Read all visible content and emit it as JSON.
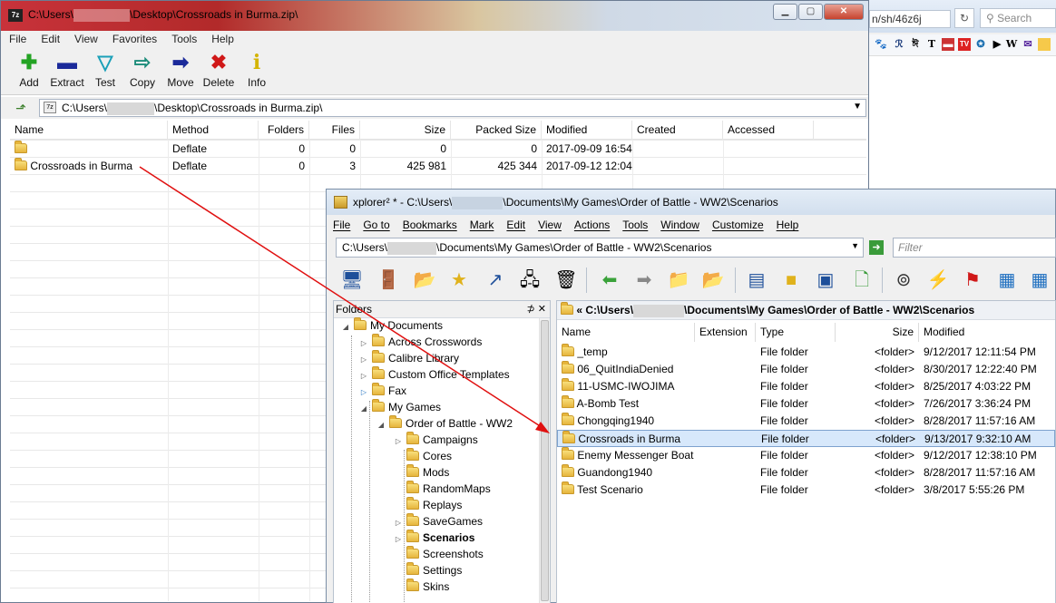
{
  "browser": {
    "url_fragment": "n/sh/46z6j",
    "search_placeholder": "Search"
  },
  "sevenzip": {
    "title_prefix": "C:\\Users\\",
    "title_suffix": "\\Desktop\\Crossroads in Burma.zip\\",
    "menu": [
      "File",
      "Edit",
      "View",
      "Favorites",
      "Tools",
      "Help"
    ],
    "toolbar": [
      {
        "label": "Add",
        "icon": "add-icon",
        "color": "#23a323"
      },
      {
        "label": "Extract",
        "icon": "extract-icon",
        "color": "#1b2a9a"
      },
      {
        "label": "Test",
        "icon": "test-icon",
        "color": "#1aa0b8"
      },
      {
        "label": "Copy",
        "icon": "copy-icon",
        "color": "#1c8c7a"
      },
      {
        "label": "Move",
        "icon": "move-icon",
        "color": "#1b2a9a"
      },
      {
        "label": "Delete",
        "icon": "delete-icon",
        "color": "#d01818"
      },
      {
        "label": "Info",
        "icon": "info-icon",
        "color": "#d4b400"
      }
    ],
    "address_prefix": "C:\\Users\\",
    "address_suffix": "\\Desktop\\Crossroads in Burma.zip\\",
    "columns": [
      "Name",
      "Method",
      "Folders",
      "Files",
      "Size",
      "Packed Size",
      "Modified",
      "Created",
      "Accessed"
    ],
    "rows": [
      {
        "name": "",
        "method": "Deflate",
        "folders": "0",
        "files": "0",
        "size": "0",
        "packed": "0",
        "modified": "2017-09-09 16:54",
        "created": "",
        "accessed": ""
      },
      {
        "name": "Crossroads in Burma",
        "method": "Deflate",
        "folders": "0",
        "files": "3",
        "size": "425 981",
        "packed": "425 344",
        "modified": "2017-09-12 12:04",
        "created": "",
        "accessed": ""
      }
    ]
  },
  "xplorer": {
    "title_prefix": "xplorer² * - C:\\Users\\",
    "title_suffix": "\\Documents\\My Games\\Order of Battle - WW2\\Scenarios",
    "menu": [
      "File",
      "Go to",
      "Bookmarks",
      "Mark",
      "Edit",
      "View",
      "Actions",
      "Tools",
      "Window",
      "Customize",
      "Help"
    ],
    "address_prefix": "C:\\Users\\",
    "address_suffix": "\\Documents\\My Games\\Order of Battle - WW2\\Scenarios",
    "filter_placeholder": "Filter",
    "folders_header": "Folders",
    "tree": [
      {
        "label": "My Documents",
        "level": 0,
        "exp": "◢"
      },
      {
        "label": "Across Crosswords",
        "level": 1,
        "exp": "▷"
      },
      {
        "label": "Calibre Library",
        "level": 1,
        "exp": "▷"
      },
      {
        "label": "Custom Office Templates",
        "level": 1,
        "exp": "▷"
      },
      {
        "label": "Fax",
        "level": 1,
        "exp": "▷"
      },
      {
        "label": "My Games",
        "level": 1,
        "exp": "◢"
      },
      {
        "label": "Order of Battle - WW2",
        "level": 2,
        "exp": "◢"
      },
      {
        "label": "Campaigns",
        "level": 3,
        "exp": "▷"
      },
      {
        "label": "Cores",
        "level": 3,
        "exp": ""
      },
      {
        "label": "Mods",
        "level": 3,
        "exp": ""
      },
      {
        "label": "RandomMaps",
        "level": 3,
        "exp": ""
      },
      {
        "label": "Replays",
        "level": 3,
        "exp": ""
      },
      {
        "label": "SaveGames",
        "level": 3,
        "exp": "▷"
      },
      {
        "label": "Scenarios",
        "level": 3,
        "exp": "▷",
        "bold": true
      },
      {
        "label": "Screenshots",
        "level": 3,
        "exp": ""
      },
      {
        "label": "Settings",
        "level": 3,
        "exp": ""
      },
      {
        "label": "Skins",
        "level": 3,
        "exp": ""
      }
    ],
    "list_path_prefix": "« C:\\Users\\",
    "list_path_suffix": "\\Documents\\My Games\\Order of Battle - WW2\\Scenarios",
    "columns": [
      "Name",
      "Extension",
      "Type",
      "Size",
      "Modified"
    ],
    "rows": [
      {
        "name": "_temp",
        "ext": "",
        "type": "File folder",
        "size": "<folder>",
        "modified": "9/12/2017 12:11:54 PM"
      },
      {
        "name": "06_QuitIndiaDenied",
        "ext": "",
        "type": "File folder",
        "size": "<folder>",
        "modified": "8/30/2017 12:22:40 PM"
      },
      {
        "name": "11-USMC-IWOJIMA",
        "ext": "",
        "type": "File folder",
        "size": "<folder>",
        "modified": "8/25/2017 4:03:22 PM"
      },
      {
        "name": "A-Bomb Test",
        "ext": "",
        "type": "File folder",
        "size": "<folder>",
        "modified": "7/26/2017 3:36:24 PM"
      },
      {
        "name": "Chongqing1940",
        "ext": "",
        "type": "File folder",
        "size": "<folder>",
        "modified": "8/28/2017 11:57:16 AM"
      },
      {
        "name": "Crossroads in Burma",
        "ext": "",
        "type": "File folder",
        "size": "<folder>",
        "modified": "9/13/2017 9:32:10 AM",
        "selected": true
      },
      {
        "name": "Enemy Messenger Boat",
        "ext": "",
        "type": "File folder",
        "size": "<folder>",
        "modified": "9/12/2017 12:38:10 PM"
      },
      {
        "name": "Guandong1940",
        "ext": "",
        "type": "File folder",
        "size": "<folder>",
        "modified": "8/28/2017 11:57:16 AM"
      },
      {
        "name": "Test Scenario",
        "ext": "",
        "type": "File folder",
        "size": "<folder>",
        "modified": "3/8/2017 5:55:26 PM"
      }
    ]
  },
  "colors": {
    "arrow": "#e01010",
    "selection": "#d7e8fb"
  }
}
